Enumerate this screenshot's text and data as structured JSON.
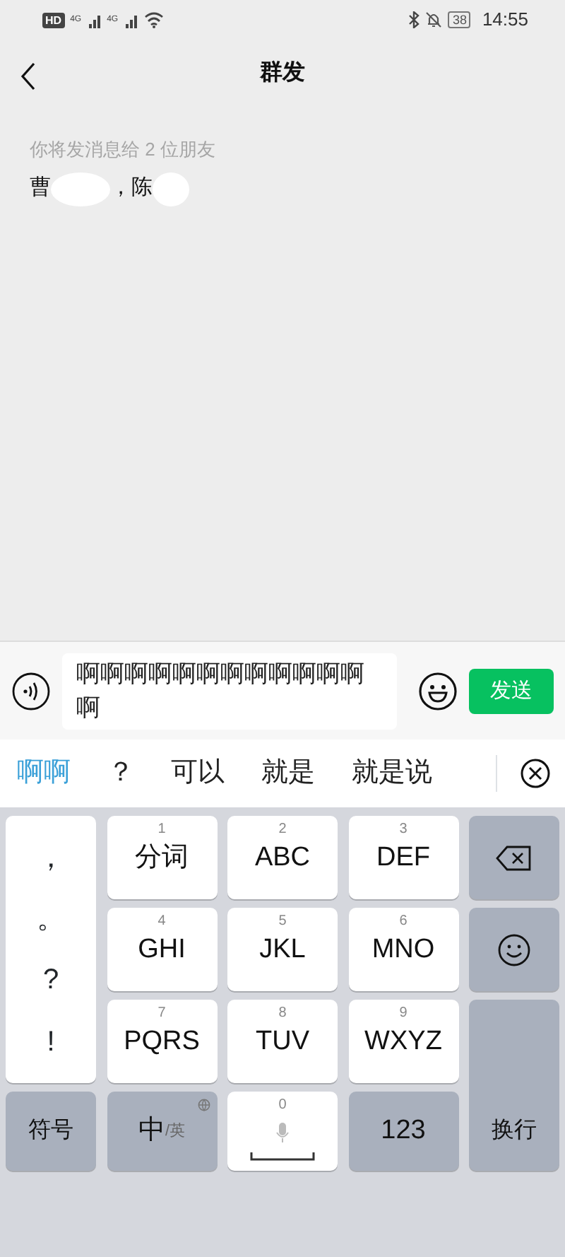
{
  "status_bar": {
    "hd": "HD",
    "networks": [
      "4G",
      "4G"
    ],
    "battery": "38",
    "time": "14:55"
  },
  "header": {
    "title": "群发"
  },
  "recipients": {
    "hint": "你将发消息给 2 位朋友",
    "name_parts": [
      "曹",
      "，陈"
    ]
  },
  "composer": {
    "value": "啊啊啊啊啊啊啊啊啊啊啊啊啊",
    "send": "发送"
  },
  "candidates": [
    {
      "text": "啊啊",
      "selected": true
    },
    {
      "text": "？",
      "selected": false
    },
    {
      "text": "可以",
      "selected": false
    },
    {
      "text": "就是",
      "selected": false
    },
    {
      "text": "就是说",
      "selected": false
    }
  ],
  "keyboard": {
    "punctuation": [
      "，",
      "。",
      "?",
      "!"
    ],
    "t9": [
      {
        "digit": "1",
        "label": "分词"
      },
      {
        "digit": "2",
        "label": "ABC"
      },
      {
        "digit": "3",
        "label": "DEF"
      },
      {
        "digit": "4",
        "label": "GHI"
      },
      {
        "digit": "5",
        "label": "JKL"
      },
      {
        "digit": "6",
        "label": "MNO"
      },
      {
        "digit": "7",
        "label": "PQRS"
      },
      {
        "digit": "8",
        "label": "TUV"
      },
      {
        "digit": "9",
        "label": "WXYZ"
      }
    ],
    "enter": "换行",
    "symbols": "符号",
    "lang_main": "中",
    "lang_alt": "/英",
    "space_digit": "0",
    "numbers": "123"
  }
}
